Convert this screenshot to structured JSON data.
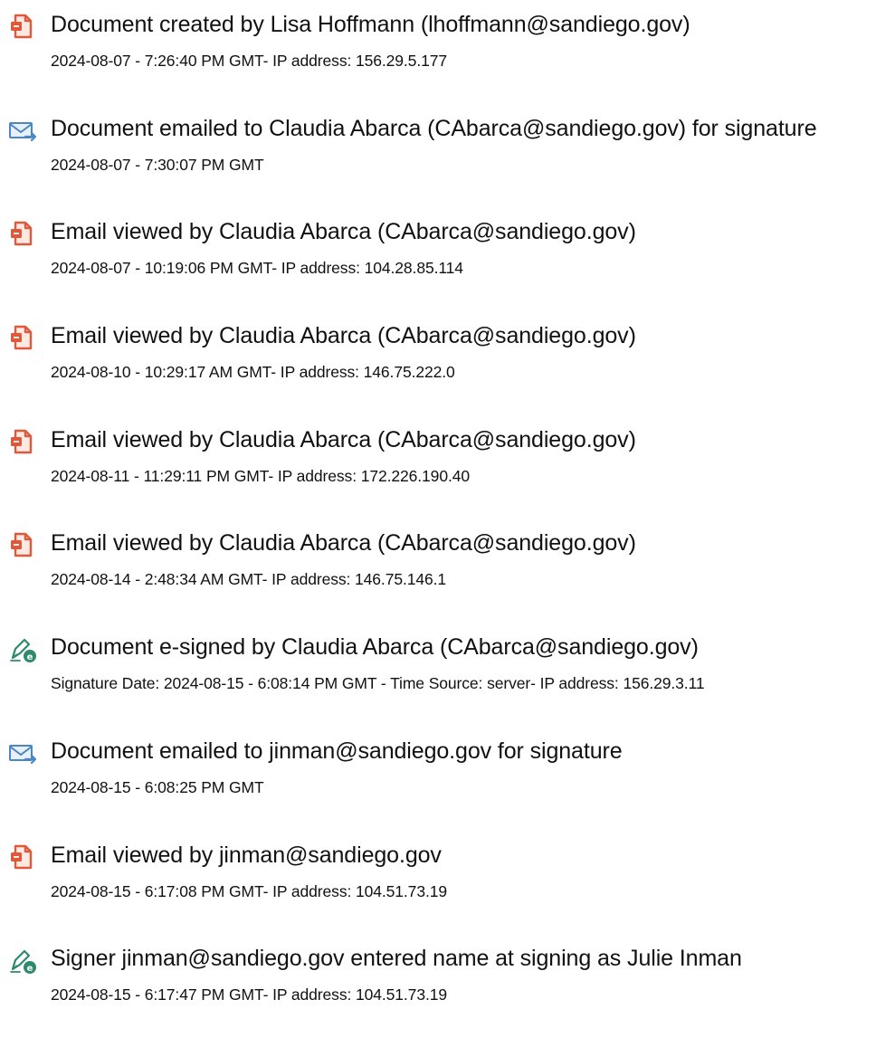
{
  "colors": {
    "doc_icon": "#e0583a",
    "mail_icon": "#4a86c8",
    "sign_icon": "#2e8a6a",
    "text": "#111111"
  },
  "events": [
    {
      "icon": "document-icon",
      "title": "Document created by Lisa Hoffmann (lhoffmann@sandiego.gov)",
      "detail": "2024-08-07 - 7:26:40 PM GMT- IP address: 156.29.5.177"
    },
    {
      "icon": "email-sent-icon",
      "title": "Document emailed to Claudia Abarca (CAbarca@sandiego.gov) for signature",
      "detail": "2024-08-07 - 7:30:07 PM GMT"
    },
    {
      "icon": "document-icon",
      "title": "Email viewed by Claudia Abarca (CAbarca@sandiego.gov)",
      "detail": "2024-08-07 - 10:19:06 PM GMT- IP address: 104.28.85.114"
    },
    {
      "icon": "document-icon",
      "title": "Email viewed by Claudia Abarca (CAbarca@sandiego.gov)",
      "detail": "2024-08-10 - 10:29:17 AM GMT- IP address: 146.75.222.0"
    },
    {
      "icon": "document-icon",
      "title": "Email viewed by Claudia Abarca (CAbarca@sandiego.gov)",
      "detail": "2024-08-11 - 11:29:11 PM GMT- IP address: 172.226.190.40"
    },
    {
      "icon": "document-icon",
      "title": "Email viewed by Claudia Abarca (CAbarca@sandiego.gov)",
      "detail": "2024-08-14 - 2:48:34 AM GMT- IP address: 146.75.146.1"
    },
    {
      "icon": "esign-pen-icon",
      "title": "Document e-signed by Claudia Abarca (CAbarca@sandiego.gov)",
      "detail": "Signature Date: 2024-08-15 - 6:08:14 PM GMT - Time Source: server- IP address: 156.29.3.11"
    },
    {
      "icon": "email-sent-icon",
      "title": "Document emailed to jinman@sandiego.gov for signature",
      "detail": "2024-08-15 - 6:08:25 PM GMT"
    },
    {
      "icon": "document-icon",
      "title": "Email viewed by jinman@sandiego.gov",
      "detail": "2024-08-15 - 6:17:08 PM GMT- IP address: 104.51.73.19"
    },
    {
      "icon": "esign-pen-icon",
      "title": "Signer jinman@sandiego.gov entered name at signing as Julie Inman",
      "detail": "2024-08-15 - 6:17:47 PM GMT- IP address: 104.51.73.19"
    }
  ]
}
